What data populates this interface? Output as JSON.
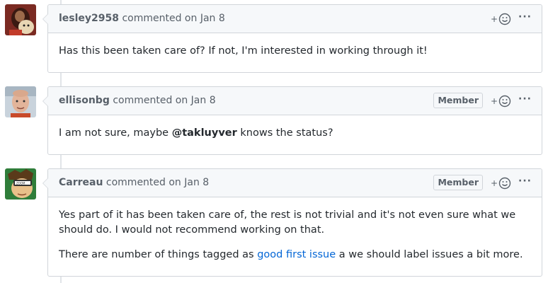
{
  "comments": [
    {
      "author": "lesley2958",
      "action": "commented on",
      "date": "Jan 8",
      "badge": "",
      "body": "Has this been taken care of? If not, I'm interested in working through it!"
    },
    {
      "author": "ellisonbg",
      "action": "commented on",
      "date": "Jan 8",
      "badge": "Member",
      "body_before": "I am not sure, maybe ",
      "mention": "@takluyver",
      "body_after": " knows the status?"
    },
    {
      "author": "Carreau",
      "action": "commented on",
      "date": "Jan 8",
      "badge": "Member",
      "body_p1": "Yes part of it has been taken care of, the rest is not trivial and it's not even sure what we should do. I would not recommend working on that.",
      "body_p2_before": "There are number of things tagged as ",
      "body_p2_link": "good first issue",
      "body_p2_after": " a we should label issues a bit more."
    }
  ],
  "icons": {
    "reaction": "add-reaction-icon",
    "more": "more-options-icon"
  },
  "colors": {
    "link": "#0366d6",
    "header_bg": "#f6f8fa",
    "border": "#d1d5da"
  }
}
